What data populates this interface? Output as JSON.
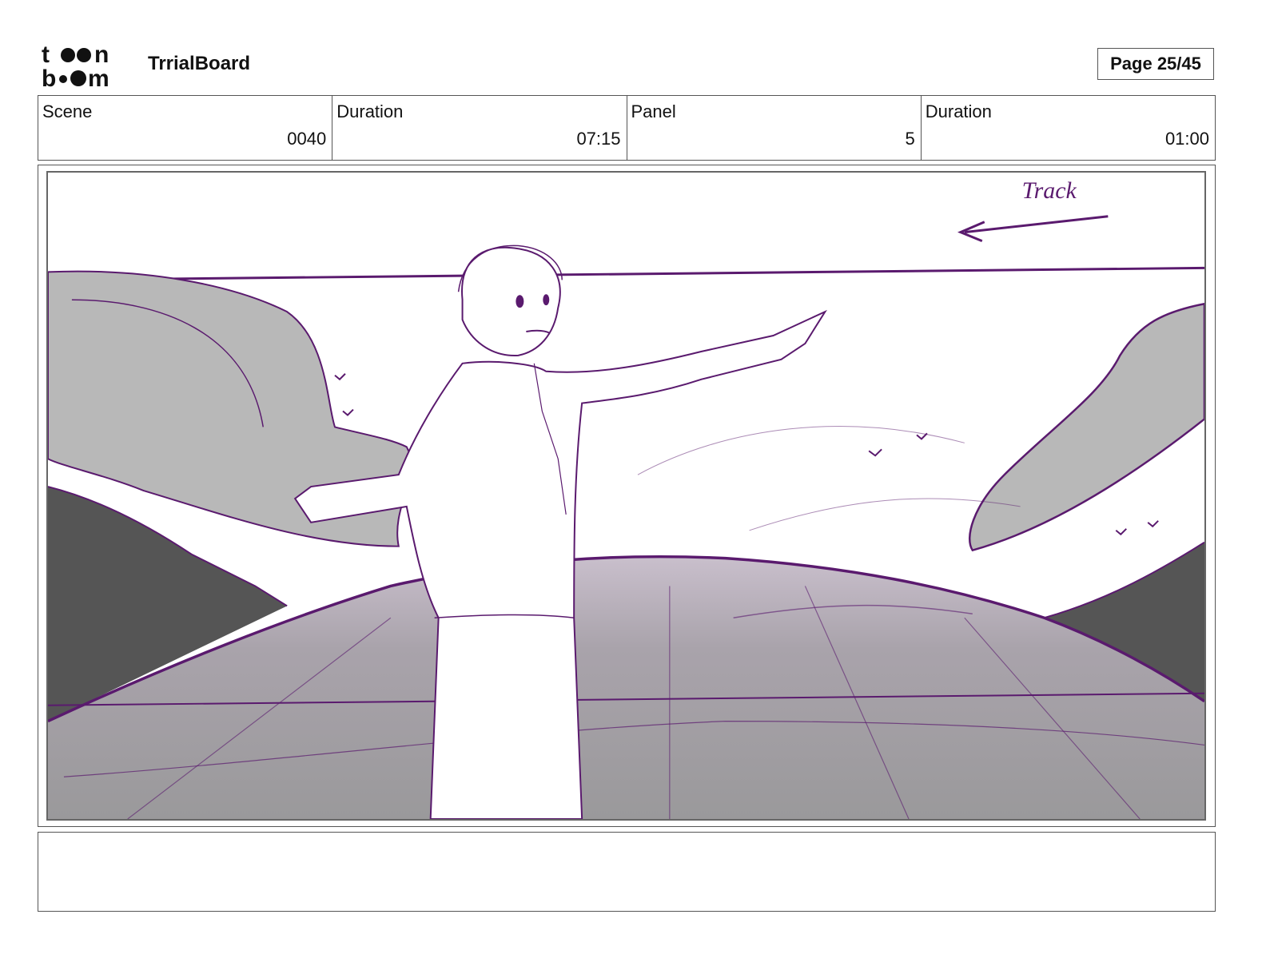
{
  "header": {
    "logo_text": "toon boom",
    "project_title": "TrrialBoard",
    "page_label": "Page 25/45"
  },
  "info": [
    {
      "label": "Scene",
      "value": "0040"
    },
    {
      "label": "Duration",
      "value": "07:15"
    },
    {
      "label": "Panel",
      "value": "5"
    },
    {
      "label": "Duration",
      "value": "01:00"
    }
  ],
  "panel": {
    "annotation": "Track",
    "sketch_color": "#5a1a6e"
  },
  "caption": {
    "text": ""
  }
}
